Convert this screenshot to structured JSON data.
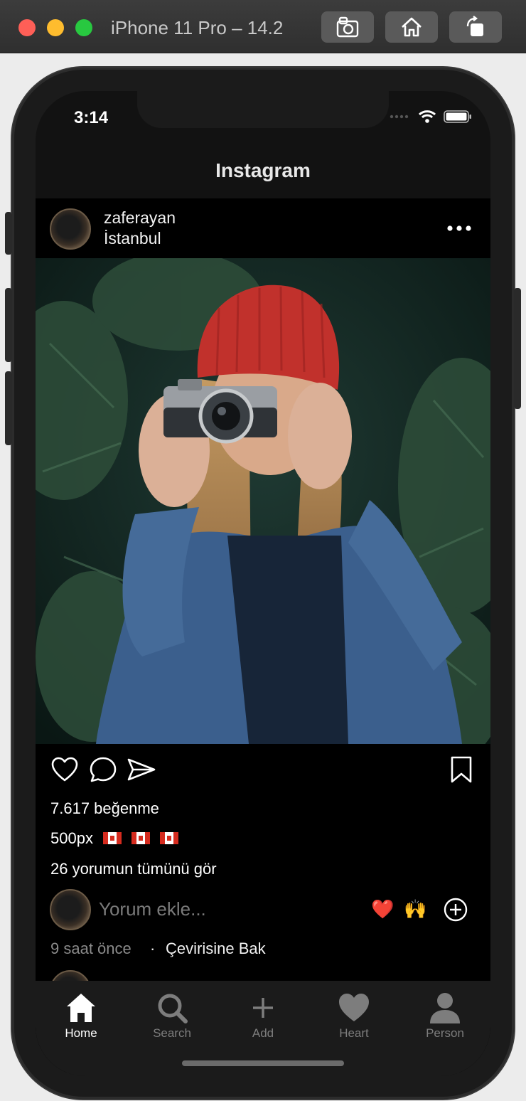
{
  "window": {
    "title": "iPhone 11 Pro – 14.2",
    "buttons": [
      "screenshot-icon",
      "home-icon",
      "rotate-icon"
    ]
  },
  "status_bar": {
    "time": "3:14"
  },
  "nav": {
    "title": "Instagram"
  },
  "post": {
    "username": "zaferayan",
    "location": "İstanbul",
    "likes": "7.617 beğenme",
    "caption_user": "500px",
    "view_comments": "26 yorumun tümünü gör",
    "comment_placeholder": "Yorum ekle...",
    "quick_emojis": [
      "❤️",
      "🙌"
    ],
    "time_ago": "9 saat önce",
    "separator": "·",
    "translate": "Çevirisine Bak"
  },
  "tabbar": {
    "items": [
      {
        "label": "Home",
        "icon": "home-icon",
        "active": true
      },
      {
        "label": "Search",
        "icon": "search-icon",
        "active": false
      },
      {
        "label": "Add",
        "icon": "plus-icon",
        "active": false
      },
      {
        "label": "Heart",
        "icon": "heart-icon",
        "active": false
      },
      {
        "label": "Person",
        "icon": "person-icon",
        "active": false
      }
    ]
  },
  "colors": {
    "background": "#000000",
    "tabbar": "#1b1b1b",
    "inactive_tab": "#7d7d7d"
  }
}
